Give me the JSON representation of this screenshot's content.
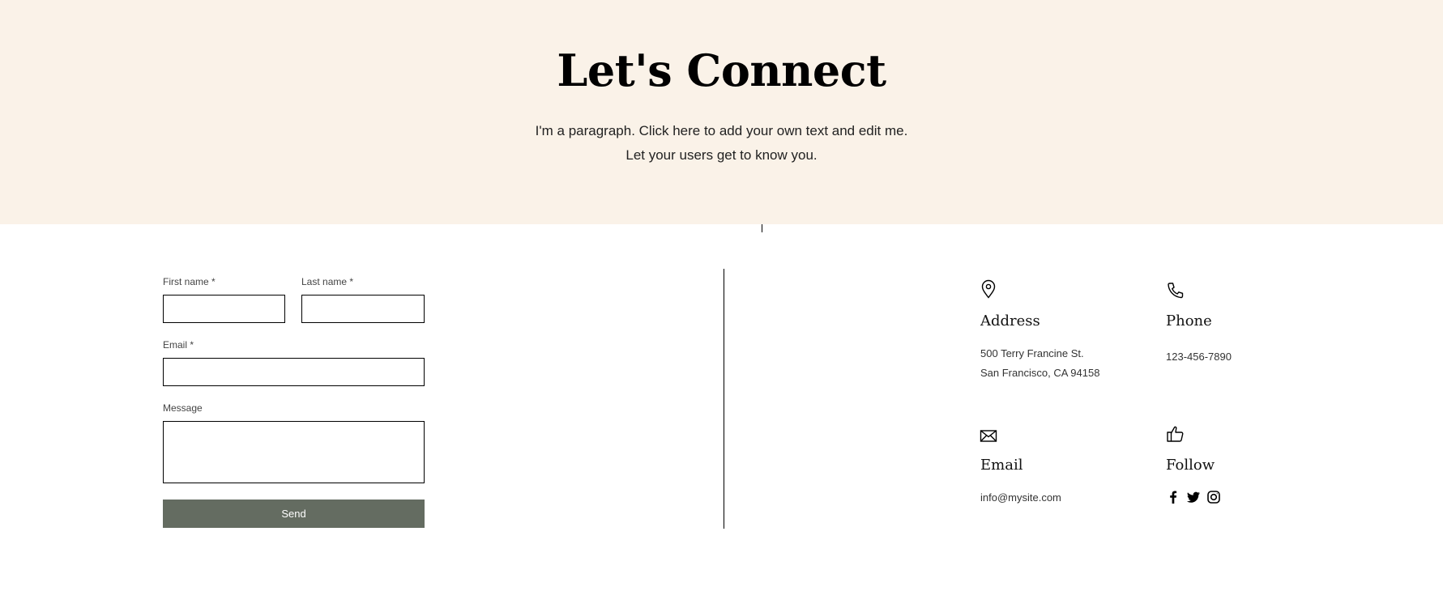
{
  "hero": {
    "title": "Let's Connect",
    "paragraph_line1": "I'm a paragraph. Click here to add your own text and edit me.",
    "paragraph_line2": "Let your users get to know you."
  },
  "form": {
    "first_name_label": "First name *",
    "last_name_label": "Last name *",
    "email_label": "Email *",
    "message_label": "Message",
    "first_name_value": "",
    "last_name_value": "",
    "email_value": "",
    "message_value": "",
    "send_label": "Send"
  },
  "contact": {
    "address": {
      "icon": "map-pin-icon",
      "heading": "Address",
      "line1": "500 Terry Francine St.",
      "line2": "San Francisco, CA 94158"
    },
    "phone": {
      "icon": "phone-icon",
      "heading": "Phone",
      "value": "123-456-7890"
    },
    "email": {
      "icon": "envelope-icon",
      "heading": "Email",
      "value": "info@mysite.com"
    },
    "follow": {
      "icon": "thumbs-up-icon",
      "heading": "Follow",
      "networks": [
        "facebook-icon",
        "twitter-icon",
        "instagram-icon"
      ]
    }
  },
  "colors": {
    "hero_background": "#faf2e8",
    "send_button": "#646c61",
    "text": "#000000"
  }
}
